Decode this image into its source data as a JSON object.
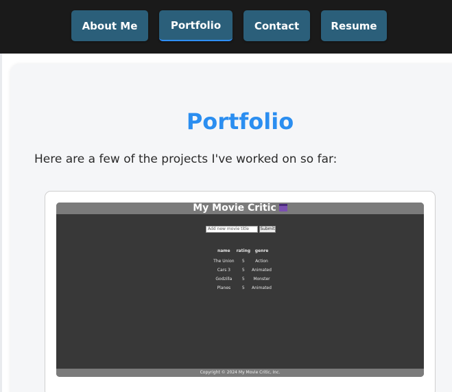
{
  "nav": {
    "items": [
      {
        "label": "About Me"
      },
      {
        "label": "Portfolio"
      },
      {
        "label": "Contact"
      },
      {
        "label": "Resume"
      }
    ],
    "active": "Portfolio"
  },
  "main": {
    "title": "Portfolio",
    "intro": "Here are a few of the projects I've worked on so far:"
  },
  "project": {
    "app_title": "My Movie Critic",
    "app_icon": "clapperboard-icon",
    "input_placeholder": "Add new movie title",
    "submit_label": "Submit",
    "table": {
      "headers": [
        "name",
        "rating",
        "genre"
      ],
      "rows": [
        [
          "The Union",
          "5",
          "Action"
        ],
        [
          "Cars 3",
          "5",
          "Animated"
        ],
        [
          "Godzilla",
          "5",
          "Monster"
        ],
        [
          "Planes",
          "5",
          "Animated"
        ]
      ]
    },
    "footer": "Copyright © 2024 My Movie Critic, Inc."
  },
  "colors": {
    "nav_bg": "#1a1a1a",
    "nav_button": "#2b5f7a",
    "title": "#2b8ef0",
    "active_underline": "#2f8fff"
  }
}
